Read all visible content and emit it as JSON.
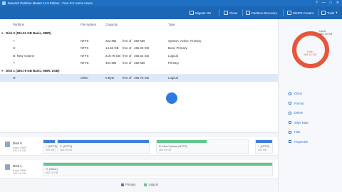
{
  "window": {
    "title": "EaseUS Partition Master 14.5 Edition - Free For Home Users",
    "controls": [
      "?",
      "—",
      "□",
      "✕"
    ]
  },
  "toolbar": {
    "buttons": [
      {
        "label": "Migrate OS",
        "icon": "migrate-icon"
      },
      {
        "label": "Clone",
        "icon": "clone-icon"
      },
      {
        "label": "Partition Recovery",
        "icon": "recovery-icon"
      },
      {
        "label": "WinPE Creator",
        "icon": "winpe-icon"
      },
      {
        "label": "Tools",
        "icon": "tools-icon"
      }
    ]
  },
  "table": {
    "headers": [
      "Partition",
      "File system",
      "Capacity",
      "Type"
    ],
    "rows": [
      {
        "kind": "disk",
        "name": "Disk 0 (931.51 GB Basic, MBR)"
      },
      {
        "kind": "part",
        "name": "*:",
        "fs": "NTFS",
        "used": "222 MB",
        "free_label": "free of",
        "total": "350 MB",
        "type": "System, Active, Primary"
      },
      {
        "kind": "part",
        "name": "C:",
        "fs": "NTFS",
        "used": "14.66 GB",
        "free_label": "free of",
        "total": "465.03 GB",
        "type": "Boot, Primary"
      },
      {
        "kind": "part",
        "name": "D: New Volume",
        "fs": "NTFS",
        "used": "216.79 GB",
        "free_label": "free of",
        "total": "465.54 GB",
        "type": "Logical"
      },
      {
        "kind": "part",
        "name": "*:",
        "fs": "NTFS",
        "used": "434 MB",
        "free_label": "free of",
        "total": "450 MB",
        "type": "Primary"
      },
      {
        "kind": "disk",
        "name": "Disk 1 (465.76 GB Basic, MBR, USB)"
      },
      {
        "kind": "part",
        "name": "H:",
        "fs": "Other",
        "used": "0 Byte",
        "free_label": "free of",
        "total": "465.76 GB",
        "type": "Logical",
        "selected": true
      }
    ]
  },
  "disk_map": {
    "disks": [
      {
        "name": "Disk 0",
        "sub1": "Basic MBR",
        "sub2": "931.51 GB",
        "segments": [
          {
            "label": "*: (NTFS)",
            "size": "350 MB",
            "color": "#3f7fd9"
          },
          {
            "label": "C: (NTFS)",
            "size": "465.03 GB",
            "color": "#3f7fd9"
          },
          {
            "label": "D: New Volume (NTFS)",
            "size": "465.54 GB",
            "color": "#5fc98a"
          },
          {
            "label": "*: (NTFS)",
            "size": "450 MB",
            "color": "#3f7fd9"
          }
        ]
      },
      {
        "name": "Disk 1",
        "sub1": "Basic MBR",
        "sub2": "465.76 GB",
        "segments": [
          {
            "label": "H: (Other)",
            "size": "465.76 GB",
            "color": "#5fc98a"
          }
        ]
      }
    ],
    "legend": [
      {
        "label": "Primary",
        "color": "#3f7fd9"
      },
      {
        "label": "Logical",
        "color": "#5fc98a"
      }
    ]
  },
  "side": {
    "used_label": "Used",
    "used_value": "465.76 GB",
    "free_label": "Free",
    "free_value": "465.76 GB",
    "used_fraction": 1.0,
    "donut_color": "#e8553a",
    "operations": [
      "Clone",
      "Format",
      "Delete",
      "Wipe Data",
      "Hide",
      "Properties"
    ]
  }
}
